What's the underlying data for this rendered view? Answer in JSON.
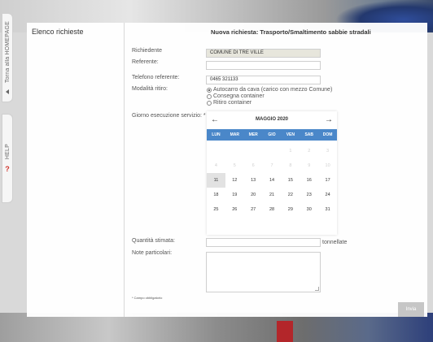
{
  "sidebar": {
    "homepage_label": "Torna alla HOMEPAGE",
    "help_label": "HELP",
    "help_icon": "?"
  },
  "left": {
    "title": "Elenco richieste"
  },
  "form": {
    "title": "Nuova richiesta: Trasporto/Smaltimento sabbie stradali",
    "requester_label": "Richiedente",
    "requester_value": "COMUNE DI TRE VILLE",
    "referent_label": "Referente:",
    "referent_value": "",
    "phone_label": "Telefono referente:",
    "phone_value": "0465 321133",
    "pickup_label": "Modalità ritiro:",
    "pickup_options": [
      {
        "label": "Autocarro da cava (carico con mezzo Comune)",
        "selected": true
      },
      {
        "label": "Consegna container",
        "selected": false
      },
      {
        "label": "Ritiro container",
        "selected": false
      }
    ],
    "date_label": "Giorno esecuzione servizio: *",
    "qty_label": "Quantità stimata:",
    "qty_unit": "tonnellate",
    "notes_label": "Note particolari:",
    "required_note": "* Campo obbligatorio",
    "submit_label": "Invia"
  },
  "calendar": {
    "prev_icon": "←",
    "next_icon": "→",
    "month": "MAGGIO 2020",
    "weekdays": [
      "LUN",
      "MAR",
      "MER",
      "GIO",
      "VEN",
      "SAB",
      "DOM"
    ],
    "weeks": [
      [
        "",
        "",
        "",
        "",
        "1",
        "2",
        "3"
      ],
      [
        "4",
        "5",
        "6",
        "7",
        "8",
        "9",
        "10"
      ],
      [
        "11",
        "12",
        "13",
        "14",
        "15",
        "16",
        "17"
      ],
      [
        "18",
        "19",
        "20",
        "21",
        "22",
        "23",
        "24"
      ],
      [
        "25",
        "26",
        "27",
        "28",
        "29",
        "30",
        "31"
      ]
    ],
    "disabled_through": "10",
    "highlighted": "11"
  }
}
